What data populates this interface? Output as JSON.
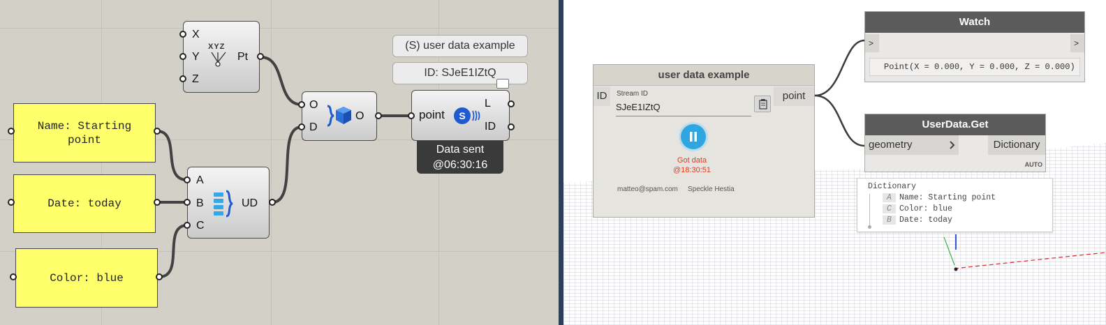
{
  "grasshopper": {
    "point_component": {
      "inputs": [
        "X",
        "Y",
        "Z"
      ],
      "output": "Pt",
      "icon_label": "XYZ"
    },
    "userdata_component": {
      "inputs": [
        "A",
        "B",
        "C"
      ],
      "output": "UD"
    },
    "merge_component": {
      "inputs": [
        "O",
        "D"
      ],
      "output": "O"
    },
    "sender_component": {
      "input": "point",
      "outputs": [
        "L",
        "ID"
      ]
    },
    "panels": [
      {
        "line1": "Name: Starting",
        "line2": "point"
      },
      {
        "line1": "Date: today"
      },
      {
        "line1": "Color: blue"
      }
    ],
    "stream_name_label": "(S) user data example",
    "stream_id_label": "ID: SJeE1IZtQ",
    "sent_status": {
      "line1": "Data sent",
      "line2": "@06:30:16"
    }
  },
  "dynamo": {
    "receiver_node": {
      "title": "user data example",
      "input": "ID",
      "stream_id_label": "Stream ID",
      "stream_id_value": "SJeE1IZtQ",
      "output": "point",
      "status": {
        "line1": "Got data",
        "line2": "@18:30:51"
      },
      "footer_email": "matteo@spam.com",
      "footer_server": "Speckle Hestia"
    },
    "watch_node": {
      "title": "Watch",
      "port": ">",
      "value": "Point(X = 0.000, Y = 0.000, Z = 0.000)"
    },
    "userdata_get_node": {
      "title": "UserData.Get",
      "input": "geometry",
      "output": "Dictionary",
      "lacing": "AUTO"
    },
    "dictionary_preview": {
      "title": "Dictionary",
      "entries": [
        {
          "key": "A",
          "value": "Name: Starting point"
        },
        {
          "key": "C",
          "value": "Color: blue"
        },
        {
          "key": "B",
          "value": "Date: today"
        }
      ]
    }
  },
  "colors": {
    "grasshopper_canvas": "#d3d0c8",
    "panel_yellow": "#ffff6b",
    "speckle_blue": "#1e7fd6",
    "status_red": "#e8381c",
    "pause_button": "#2fa6e0"
  }
}
